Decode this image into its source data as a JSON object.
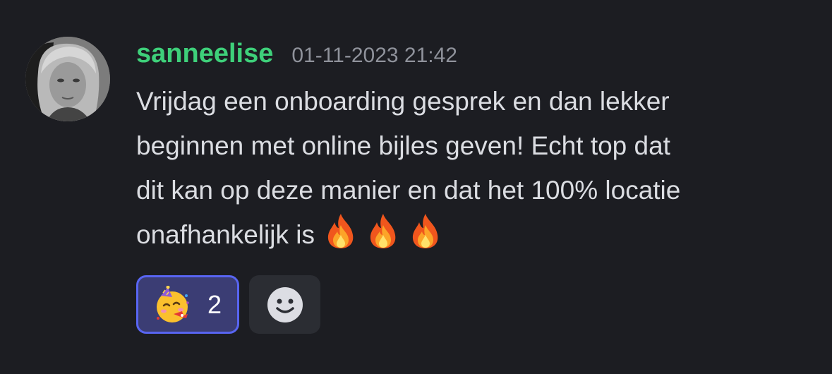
{
  "message": {
    "username": "sanneelise",
    "timestamp": "01-11-2023 21:42",
    "lines": [
      "Vrijdag een onboarding gesprek en dan lekker",
      "beginnen met online bijles geven! Echt top dat",
      "dit kan op deze manier en dat het 100% locatie",
      "onafhankelijk is"
    ],
    "inline_emojis": [
      "fire-icon",
      "fire-icon",
      "fire-icon"
    ]
  },
  "reactions": [
    {
      "emoji": "partying-face-icon",
      "count": "2",
      "active": true
    }
  ],
  "add_reaction": {
    "icon": "smiley-add-reaction-icon"
  },
  "colors": {
    "background": "#1c1d22",
    "username": "#3ed07a",
    "timestamp": "#8f929b",
    "text": "#dbdde2",
    "reaction_active_bg": "#3b3d74",
    "reaction_active_border": "#5865f2",
    "add_reaction_bg": "#2b2d33"
  }
}
